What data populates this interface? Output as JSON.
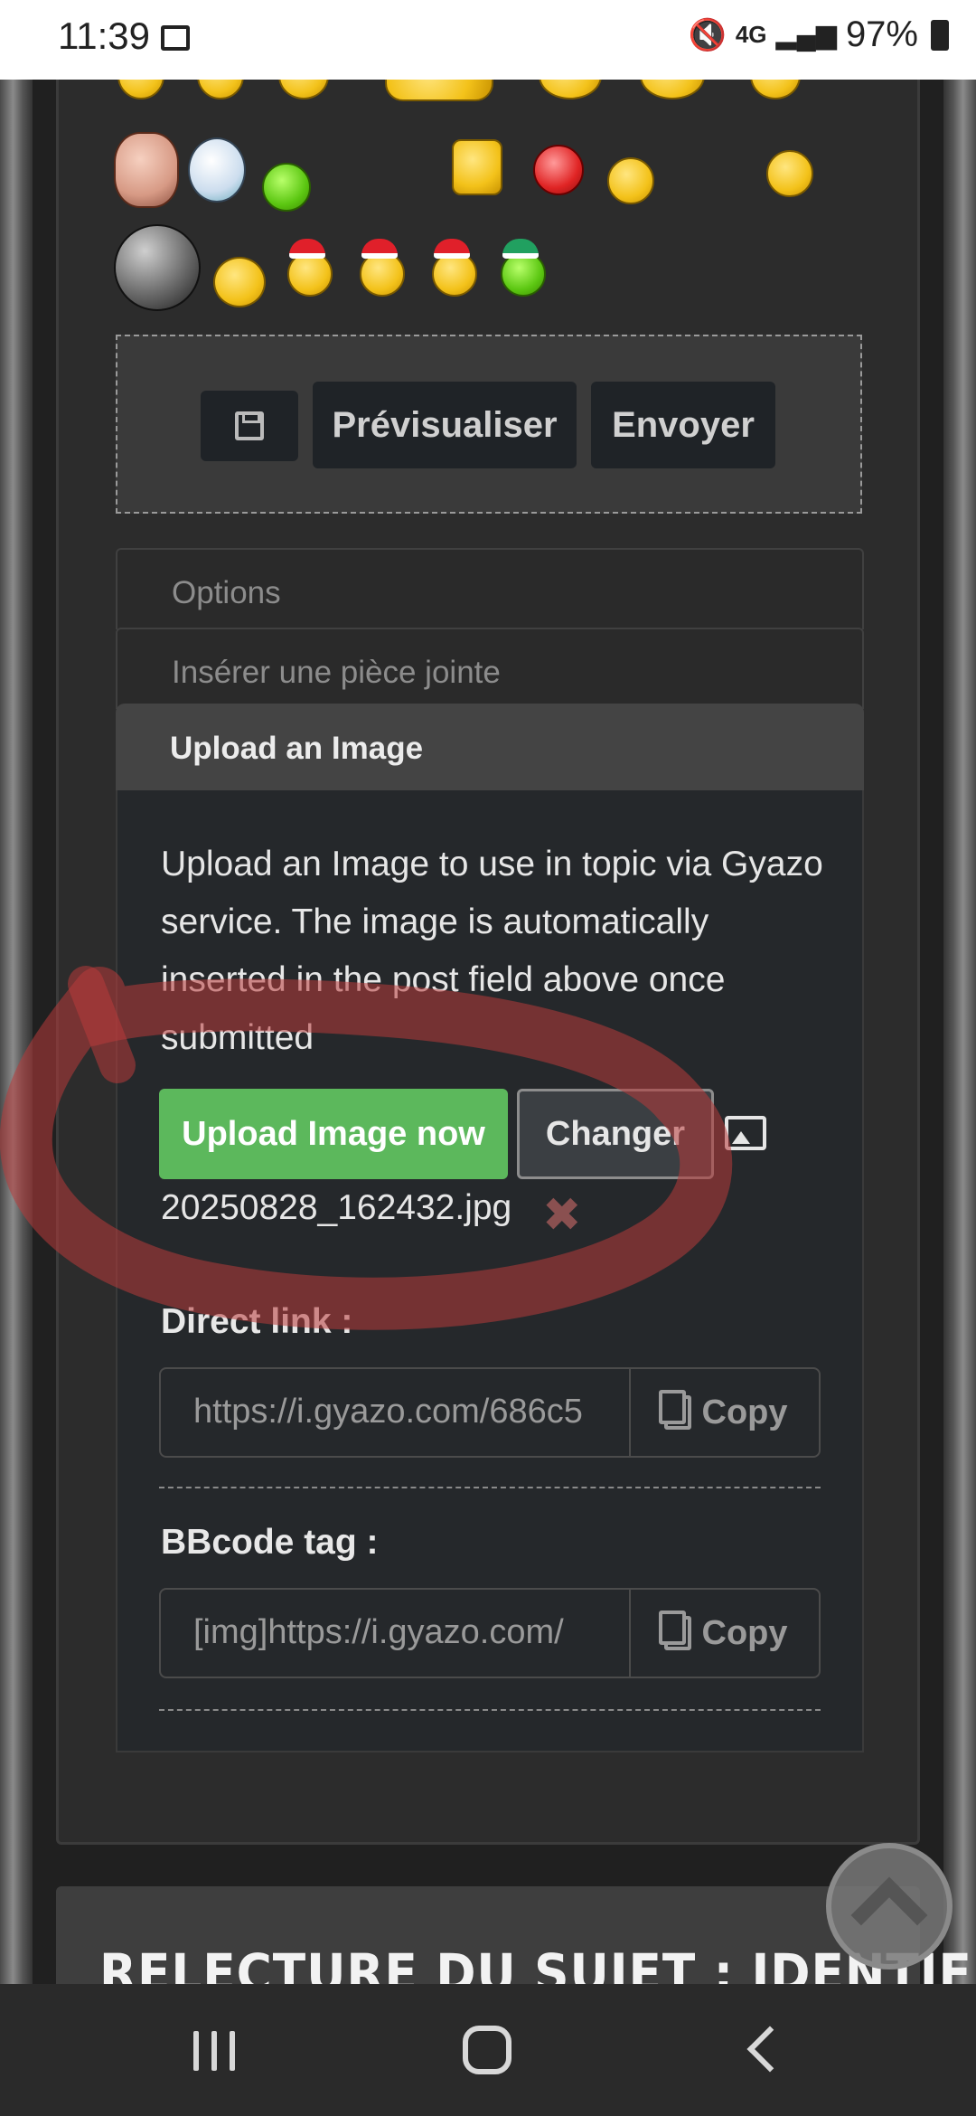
{
  "status_bar": {
    "time": "11:39",
    "network": "4G",
    "battery": "97%",
    "icons": [
      "gallery-icon",
      "mute-vibrate-icon",
      "signal-icon",
      "battery-icon"
    ]
  },
  "editor": {
    "save_draft_icon": "floppy-disk-icon",
    "preview_label": "Prévisualiser",
    "send_label": "Envoyer"
  },
  "accordion": {
    "options_label": "Options",
    "attachment_label": "Insérer une pièce jointe",
    "upload_title": "Upload an Image"
  },
  "upload": {
    "description": "Upload an Image to use in topic via Gyazo service. The image is automatically inserted in the post field above once submitted",
    "upload_button": "Upload Image now",
    "change_button": "Changer",
    "file_name": "20250828_162432.jpg",
    "remove_icon": "close-x-icon",
    "direct_link_label": "Direct link :",
    "direct_link_value": "https://i.gyazo.com/686c5",
    "bbcode_label": "BBcode tag :",
    "bbcode_value": "[img]https://i.gyazo.com/",
    "copy_label": "Copy"
  },
  "next_section": {
    "title": "RELECTURE DU SUJET : IDENTIFICATION"
  },
  "colors": {
    "accent_green": "#5cb85c",
    "panel_bg": "#25282b",
    "header_bg": "#444444",
    "annotation_red": "#b83a3a"
  }
}
